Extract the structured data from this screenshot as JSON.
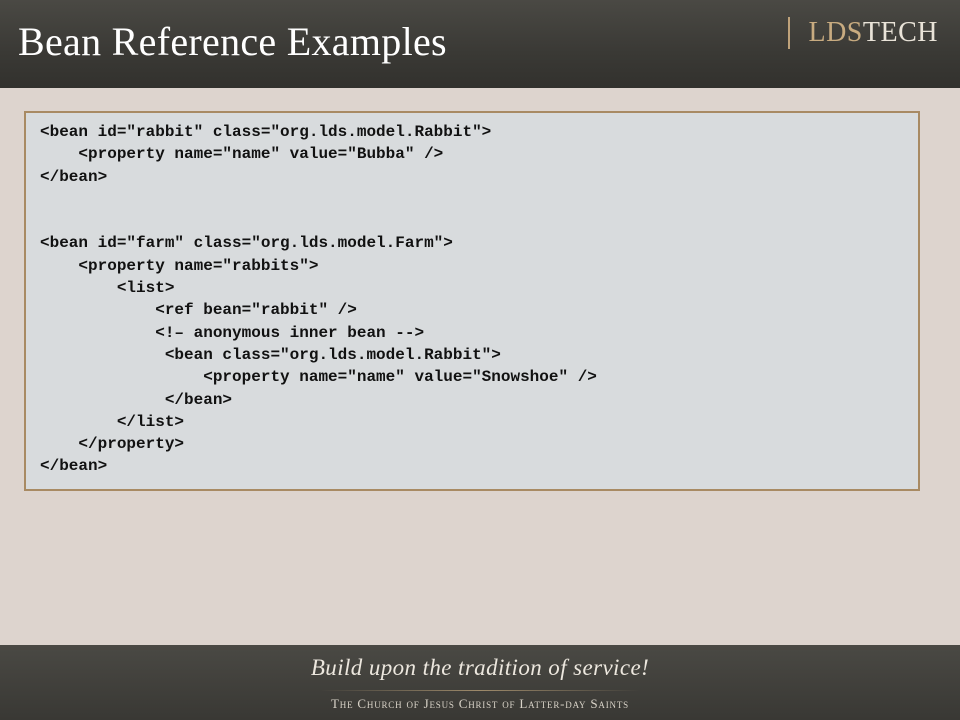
{
  "slide": {
    "title": "Bean Reference Examples",
    "brand": {
      "lds": "LDS",
      "tech": "TECH"
    }
  },
  "code": {
    "block1": [
      "<bean id=\"rabbit\" class=\"org.lds.model.Rabbit\">",
      "    <property name=\"name\" value=\"Bubba\" />",
      "</bean>"
    ],
    "block2": [
      "<bean id=\"farm\" class=\"org.lds.model.Farm\">",
      "    <property name=\"rabbits\">",
      "        <list>",
      "            <ref bean=\"rabbit\" />",
      "            <!– anonymous inner bean -->",
      "             <bean class=\"org.lds.model.Rabbit\">",
      "                 <property name=\"name\" value=\"Snowshoe\" />",
      "             </bean>",
      "        </list>",
      "    </property>",
      "</bean>"
    ]
  },
  "footer": {
    "tagline": "Build upon the tradition of service!",
    "church": "The Church of Jesus Christ of Latter-day Saints"
  },
  "colors": {
    "header_bg": "#3a3935",
    "content_bg": "#ddd4ce",
    "code_bg": "#d8dbdd",
    "code_border": "#a88a63",
    "brand_gold": "#c8ab80"
  }
}
